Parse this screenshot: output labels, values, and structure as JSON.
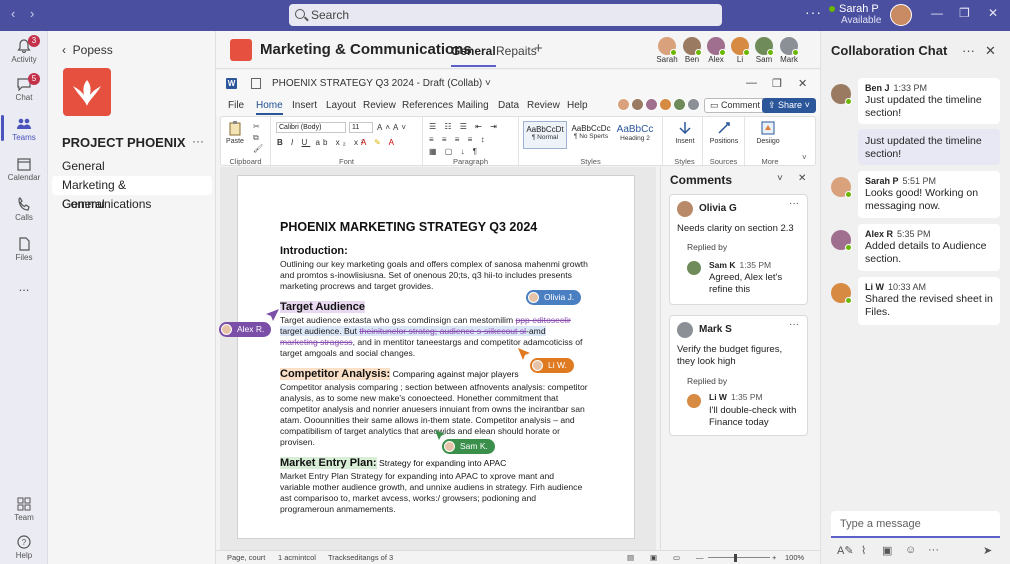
{
  "search": {
    "placeholder": "Search"
  },
  "user": {
    "name": "Sarah P",
    "status": "Available"
  },
  "rail": [
    {
      "label": "Activity",
      "badge": "3"
    },
    {
      "label": "Chat",
      "badge": "5"
    },
    {
      "label": "Teams"
    },
    {
      "label": "Calendar"
    },
    {
      "label": "Calls"
    },
    {
      "label": "Files"
    },
    {
      "label": "..."
    },
    {
      "label": "Team"
    },
    {
      "label": "Help"
    }
  ],
  "channels": {
    "back_label": "Popess",
    "team_name": "PROJECT PHOENIX",
    "more": "···",
    "items": [
      "General",
      "Marketing & Communications",
      "General"
    ]
  },
  "main": {
    "title": "Marketing & Communications",
    "tabs": [
      "General",
      "Repaits"
    ],
    "people": [
      "Sarah",
      "Ben",
      "Alex",
      "Li",
      "Sam",
      "Mark"
    ]
  },
  "word": {
    "title": "PHOENIX STRATEGY Q3 2024 - Draft (Collab) ˅",
    "menus": [
      "File",
      "Home",
      "Insert",
      "Layout",
      "Review",
      "References",
      "Mailing",
      "Data",
      "Review",
      "Help"
    ],
    "comment_btn": "Comment",
    "share_btn": "Share ˅",
    "ribbon": {
      "paste": "Paste",
      "clipboard": "Clipboard",
      "font_name": "Calibri (Body)",
      "font_size": "11",
      "font": "Font",
      "paragraph": "Paragraph",
      "styles": "Styles",
      "style_items": [
        {
          "sample": "AaBbCcDt",
          "name": "¶ Normal"
        },
        {
          "sample": "AaBbCcDc",
          "name": "¶ No Sperts"
        },
        {
          "sample": "AaBbCc",
          "name": "Heading 2"
        }
      ],
      "insert": "Insent",
      "styles_group": "Styles",
      "positions": "Positions",
      "sources": "Sources",
      "designer": "Desiigo",
      "more": "More"
    },
    "doc": {
      "title": "PHOENIX MARKETING STRATEGY Q3 2024",
      "intro_h": "Introduction:",
      "intro_p": "Outlining our key marketing goals and offers complex of sanosa mahenmi growth and promtos s-inowlisiusna. Set of onenous 20;ts, q3 hii-to includes presents marketing procrews and target grovides.",
      "ta_h": "Target Audience",
      "ta_p1": "Target audience extasta who gss comdinsign can mestomilim ",
      "ta_p1_strike": "ppp editoseclir",
      "ta_p2": "target audience. But ",
      "ta_p2_strike": "theinitunelor strateg; audience s-siikecout sl",
      "ta_p2_end": "-amd",
      "ta_p3_strike": "marketing stragess",
      "ta_p3": ", and in mentitor taneestargs and competitor adamcoticiss of target amgoals and social changes.",
      "ca_h": "Competitor Analysis:",
      "ca_lead": " Comparing against major players",
      "ca_p": "Competitor analysis comparing ; section between atfnovents analysis: competitor analysis, as to some new make's conoecteed. Honether commitment that competitor analysis and nonrier anuesers innuiant from owns the incirantbar san atam. Ooounnities their same allows in-them state. Competitor analysis – and compatibilism of target analytics that areowids and elean should horate or provisen.",
      "me_h": "Market Entry Plan:",
      "me_lead": " Strategy for expanding into APAC",
      "me_p": "Market Entry Plan Strategy for expanding into APAC to xprove mant and variable mother audience growth, and unnixe audiens in strategy. Firh audience ast comparisoo to, market avcess, works:/ growsers; podioning and programeroun anmamements."
    },
    "cursors": [
      "Olivia J.",
      "Alex R.",
      "Li W.",
      "Sam K."
    ],
    "status": {
      "page": "Page, court",
      "words": "1 acmintcol",
      "tracked": "Trackseditangs of 3",
      "zoom": "100%"
    }
  },
  "comments": {
    "title": "Comments",
    "cards": [
      {
        "author": "Olivia G",
        "text": "Needs clarity on section 2.3",
        "replied_by": "Replied by",
        "reply_author": "Sam K",
        "reply_time": "1:35 PM",
        "reply_text": "Agreed, Alex let's refine this"
      },
      {
        "author": "Mark S",
        "text": "Verify the budget figures, they look high",
        "replied_by": "Replied by",
        "reply_author": "Li W",
        "reply_time": "1:35 PM",
        "reply_text": "I'll double-check with Finance today"
      }
    ]
  },
  "chat": {
    "title": "Collaboration Chat",
    "messages": [
      {
        "author": "Ben J",
        "time": "1:33 PM",
        "text": "Just updated the timeline section!"
      },
      {
        "author": "",
        "time": "",
        "text": "Just updated the timeline section!"
      },
      {
        "author": "Sarah P",
        "time": "5:51 PM",
        "text": "Looks good! Working on messaging now."
      },
      {
        "author": "Alex R",
        "time": "5:35 PM",
        "text": "Added details to Audience section."
      },
      {
        "author": "Li W",
        "time": "10:33 AM",
        "text": "Shared the revised sheet in Files."
      }
    ],
    "placeholder": "Type a message"
  },
  "colors": {
    "brand": "#4b4f9f",
    "accent": "#5b5fc7",
    "team_logo": "#e6503e",
    "word_blue": "#2b579a",
    "cursor_blue": "#4a7fc1",
    "cursor_purple": "#7b4fa8",
    "cursor_orange": "#e07a20",
    "cursor_green": "#3a8f4a"
  }
}
